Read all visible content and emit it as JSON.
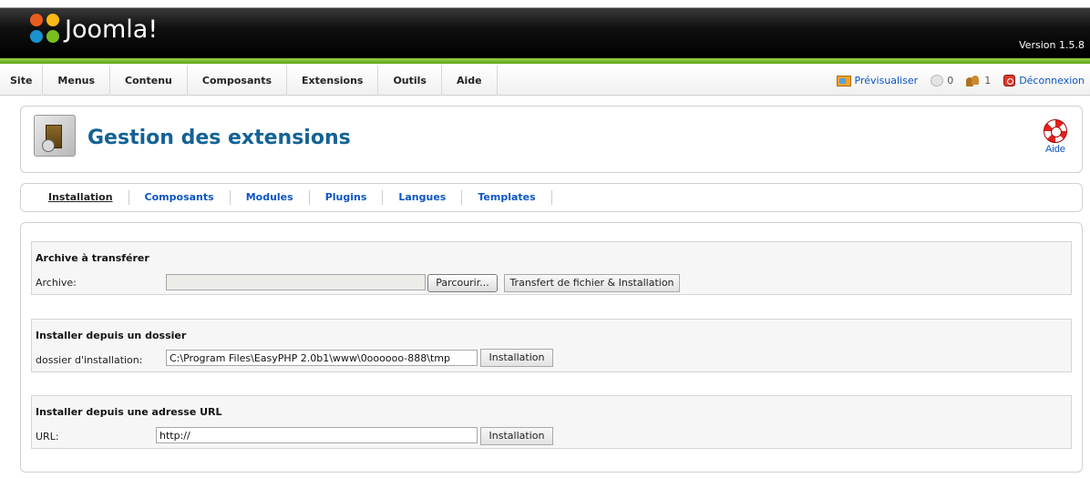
{
  "header": {
    "logo_text": "Joomla!",
    "version": "Version 1.5.8"
  },
  "menu": [
    "Site",
    "Menus",
    "Contenu",
    "Composants",
    "Extensions",
    "Outils",
    "Aide"
  ],
  "status": {
    "preview": "Prévisualiser",
    "messages_count": "0",
    "users_count": "1",
    "logout": "Déconnexion"
  },
  "page": {
    "title": "Gestion des extensions",
    "help_label": "Aide"
  },
  "submenu": {
    "items": [
      "Installation",
      "Composants",
      "Modules",
      "Plugins",
      "Langues",
      "Templates"
    ],
    "active": "Installation"
  },
  "upload": {
    "title": "Archive à transférer",
    "label": "Archive:",
    "value": "",
    "browse_button": "Parcourir...",
    "submit_button": "Transfert de fichier & Installation"
  },
  "folder": {
    "title": "Installer depuis un dossier",
    "label": "dossier d'installation:",
    "value": "C:\\Program Files\\EasyPHP 2.0b1\\www\\0oooooo-888\\tmp",
    "submit_button": "Installation"
  },
  "url": {
    "title": "Installer depuis une adresse URL",
    "label": "URL:",
    "value": "http://",
    "submit_button": "Installation"
  },
  "colors": {
    "brand_blue": "#146295",
    "link_blue": "#0b55c4",
    "accent_green": "#76b82a"
  }
}
